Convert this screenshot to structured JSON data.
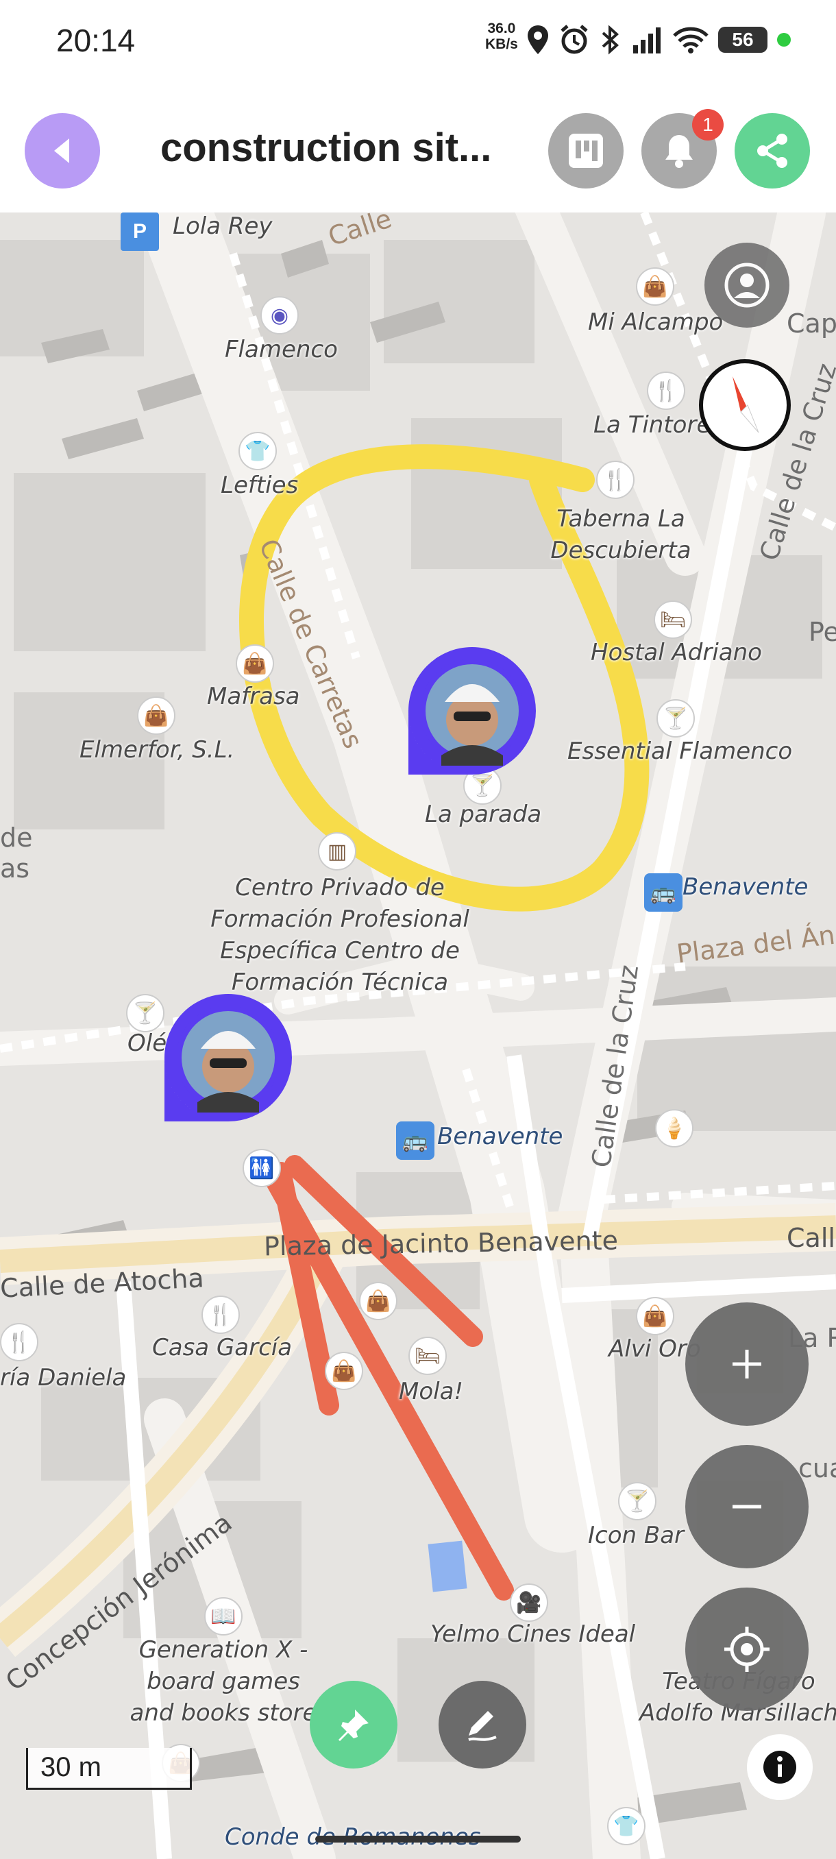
{
  "status_bar": {
    "time": "20:14",
    "net_speed_value": "36.0",
    "net_speed_unit": "KB/s",
    "battery": "56"
  },
  "header": {
    "title": "construction sit...",
    "notification_count": "1"
  },
  "map": {
    "pois": [
      {
        "label": "Lola Rey"
      },
      {
        "label": "Flamenco"
      },
      {
        "label": "Mi Alcampo"
      },
      {
        "label": "La Tintorería"
      },
      {
        "label": "Lefties"
      },
      {
        "label": "Taberna La Descubierta"
      },
      {
        "label": "Hostal Adriano"
      },
      {
        "label": "Mafrasa"
      },
      {
        "label": "Elmerfor, S.L."
      },
      {
        "label": "Essential Flamenco"
      },
      {
        "label": "La parada"
      },
      {
        "label": "Benavente"
      },
      {
        "label": "Centro Privado de Formación Profesional Específica Centro de Formación Técnica"
      },
      {
        "label": "Olé"
      },
      {
        "label": "Benavente"
      },
      {
        "label": "Casa García"
      },
      {
        "label": "ría Daniela"
      },
      {
        "label": "Mola!"
      },
      {
        "label": "Alvi Oro"
      },
      {
        "label": "Icon Bar"
      },
      {
        "label": "Yelmo Cines Ideal"
      },
      {
        "label": "Generation X - board games and books store"
      },
      {
        "label": "Teatro Fígaro Adolfo Marsillach"
      },
      {
        "label": "Conde de Romanones"
      }
    ],
    "streets": [
      {
        "label": "Calle de Carretas"
      },
      {
        "label": "Calle de la Cruz"
      },
      {
        "label": "Calle de la Cruz"
      },
      {
        "label": "Plaza del Ángel"
      },
      {
        "label": "Plaza de Jacinto Benavente"
      },
      {
        "label": "Calle de Atocha"
      },
      {
        "label": "Concepción Jerónima"
      },
      {
        "label": "Calle"
      },
      {
        "label": "Calle"
      },
      {
        "label": "Cape"
      },
      {
        "label": "Pe"
      },
      {
        "label": "La R"
      },
      {
        "label": "cua"
      },
      {
        "label": "de"
      },
      {
        "label": "as"
      }
    ],
    "scale": "30 m"
  },
  "colors": {
    "primary": "#b89bf5",
    "share": "#62d493",
    "highlight_circle": "#f7dc4a",
    "arrow": "#ea6b50",
    "avatar_ring": "#5a3cf0"
  }
}
